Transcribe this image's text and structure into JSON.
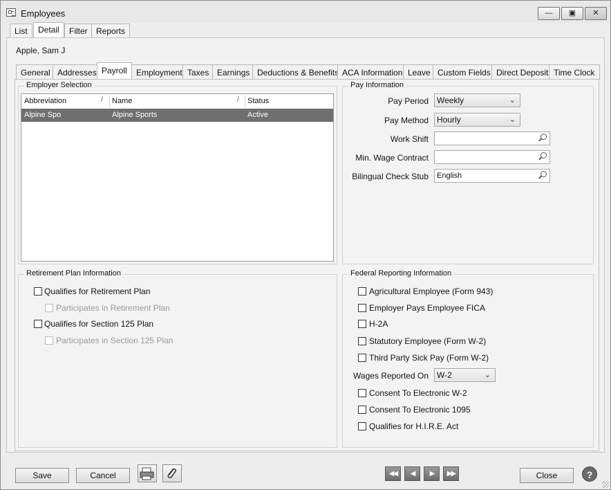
{
  "window": {
    "title": "Employees",
    "minimize_icon": "minimize-icon",
    "maximize_icon": "maximize-icon",
    "close_icon": "close-icon"
  },
  "top_tabs": [
    "List",
    "Detail",
    "Filter",
    "Reports"
  ],
  "top_tab_active": "Detail",
  "employee_name": "Apple, Sam J",
  "inner_tabs": [
    "General",
    "Addresses",
    "Payroll",
    "Employment",
    "Taxes",
    "Earnings",
    "Deductions & Benefits",
    "ACA Information",
    "Leave",
    "Custom Fields",
    "Direct Deposit",
    "Time Clock"
  ],
  "inner_tab_active": "Payroll",
  "employer_selection": {
    "title": "Employer Selection",
    "columns": [
      "Abbreviation",
      "Name",
      "Status"
    ],
    "rows": [
      {
        "abbreviation": "Alpine Spo",
        "name": "Alpine Sports",
        "status": "Active"
      }
    ]
  },
  "pay_information": {
    "title": "Pay Information",
    "pay_period_label": "Pay Period",
    "pay_period_value": "Weekly",
    "pay_method_label": "Pay Method",
    "pay_method_value": "Hourly",
    "work_shift_label": "Work Shift",
    "work_shift_value": "",
    "min_wage_label": "Min. Wage Contract",
    "min_wage_value": "",
    "bilingual_label": "Bilingual Check Stub",
    "bilingual_value": "English"
  },
  "retirement": {
    "title": "Retirement Plan Information",
    "items": [
      {
        "label": "Qualifies for Retirement Plan",
        "checked": false,
        "enabled": true
      },
      {
        "label": "Participates in Retirement Plan",
        "checked": false,
        "enabled": false
      },
      {
        "label": "Qualifies for Section 125 Plan",
        "checked": false,
        "enabled": true
      },
      {
        "label": "Participates in Section 125 Plan",
        "checked": false,
        "enabled": false
      }
    ]
  },
  "federal": {
    "title": "Federal Reporting Information",
    "items": [
      "Agricultural Employee (Form 943)",
      "Employer Pays Employee FICA",
      "H-2A",
      "Statutory Employee (Form W-2)",
      "Third Party Sick Pay (Form W-2)"
    ],
    "wages_label": "Wages Reported On",
    "wages_value": "W-2",
    "items2": [
      "Consent To Electronic W-2",
      "Consent To Electronic 1095",
      "Qualifies for H.I.R.E. Act"
    ]
  },
  "footer": {
    "save": "Save",
    "cancel": "Cancel",
    "close": "Close",
    "help": "?"
  },
  "icons": {
    "print": "print-icon",
    "attach": "paperclip-icon",
    "first": "first-record-icon",
    "prev": "previous-record-icon",
    "next": "next-record-icon",
    "last": "last-record-icon"
  }
}
